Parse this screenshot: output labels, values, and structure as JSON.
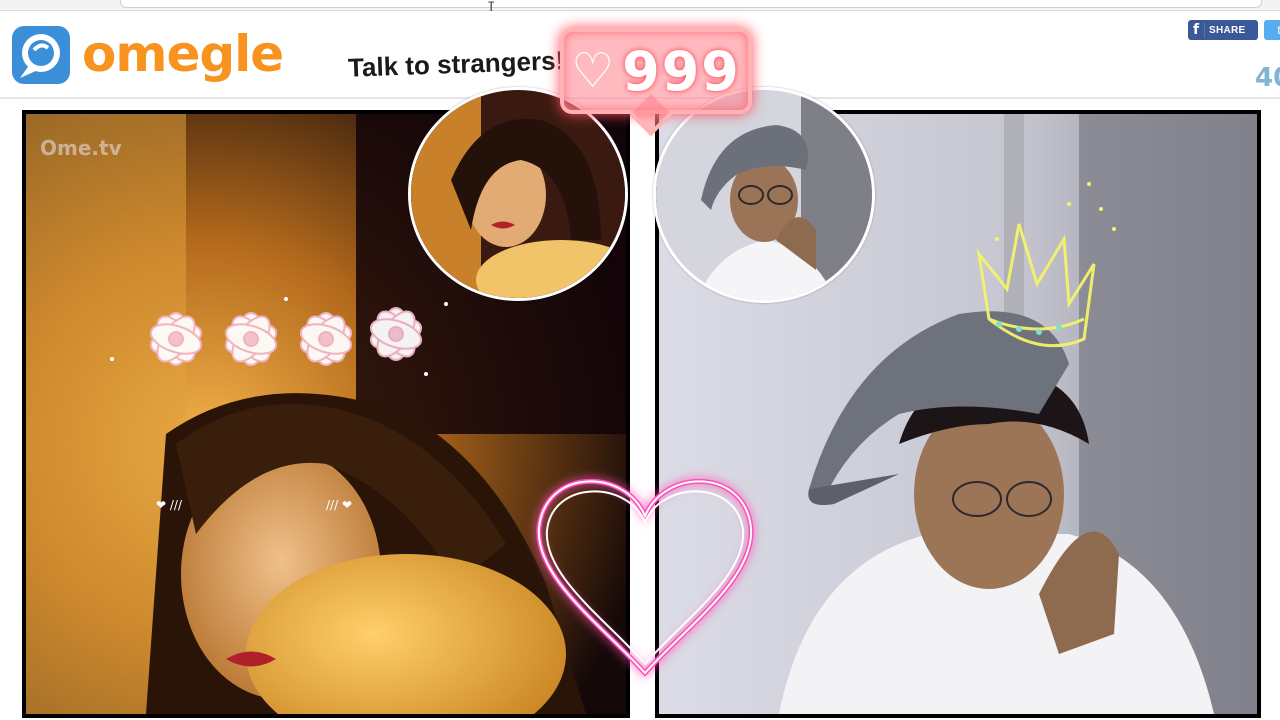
{
  "header": {
    "logo_text": "omegle",
    "tagline": "Talk to strangers!",
    "share_button_label": "SHARE",
    "facebook_glyph": "f",
    "twitter_glyph": "t",
    "online_count_partial": "40"
  },
  "left_video": {
    "watermark": "Ome.tv",
    "sticker": "flower-crown"
  },
  "right_video": {
    "sticker": "crown"
  },
  "overlay": {
    "like_icon": "heart-outline-icon",
    "like_count": "999"
  },
  "icons": {
    "logo": "omegle-chat-bubble-icon",
    "facebook": "facebook-icon",
    "twitter": "twitter-icon",
    "big_heart": "neon-heart-icon"
  },
  "colors": {
    "brand_orange": "#f7931e",
    "logo_blue": "#3a8fd8",
    "facebook_blue": "#3b5998",
    "neon_pink": "#ff4fb8",
    "neon_red": "#ff4d5e",
    "crown_yellow": "#f4f36a"
  }
}
